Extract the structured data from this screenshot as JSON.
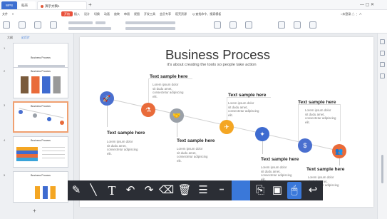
{
  "titlebar": {
    "home_tab": "WPS",
    "doc_tab": "稻壳",
    "active_tab": "演示文稿1",
    "new_tab": "+",
    "window_controls": "— ▢ ✕"
  },
  "menubar": {
    "items": [
      "文件",
      "≡",
      "开始",
      "插入",
      "设计",
      "切换",
      "动画",
      "放映",
      "审阅",
      "视图",
      "开发工具",
      "会员专享",
      "稻壳资源",
      "Q 查找命令、搜索模板"
    ],
    "right": "○未登录  △  ⋮  ∧"
  },
  "leftpanel": {
    "tabs": [
      "大纲",
      "幻灯片"
    ],
    "thumbs": [
      {
        "num": "1",
        "title": "Business Process"
      },
      {
        "num": "2",
        "title": "Business Process"
      },
      {
        "num": "3",
        "title": "Business Process"
      },
      {
        "num": "4",
        "title": "Business Process"
      },
      {
        "num": "5",
        "title": "Business Process"
      }
    ],
    "add_button": "+"
  },
  "slide": {
    "title": "Business Process",
    "subtitle": "it's about creating the tools so people take action",
    "steps": [
      {
        "title": "Text sample here",
        "lines": [
          "Lorem ipsum dolor",
          "sit dudu amet,",
          "consectetur adipiscing",
          "elit."
        ],
        "icon": "rocket-icon",
        "color": "#4a6fcf"
      },
      {
        "title": "Text sample here",
        "lines": [
          "Lorem ipsum dolor",
          "sit dudu amet,",
          "consectetur adipiscing",
          "elit."
        ],
        "icon": "flask-icon",
        "color": "#e96b3a"
      },
      {
        "title": "Text sample here",
        "lines": [
          "Lorem ipsum dolor",
          "sit dudu amet,",
          "consectetur adipiscing",
          "elit."
        ],
        "icon": "handshake-icon",
        "color": "#9aa0a8"
      },
      {
        "title": "Text sample here",
        "lines": [
          "Lorem ipsum dolor",
          "sit dudu amet,",
          "consectetur adipiscing",
          "elit."
        ],
        "icon": "paper-plane-icon",
        "color": "#f4a623"
      },
      {
        "title": "Text sample here",
        "lines": [
          "Lorem ipsum dolor",
          "sit dudu amet,",
          "consectetur adipiscing",
          "elit."
        ],
        "icon": "puzzle-icon",
        "color": "#3e6bd0"
      },
      {
        "title": "Text sample here",
        "lines": [
          "Lorem ipsum dolor",
          "sit dudu amet,",
          "consectetur adipiscing",
          "elit."
        ],
        "icon": "money-bag-icon",
        "color": "#4a6fcf"
      },
      {
        "title": "Text sample here",
        "lines": [
          "Lorem ipsum dolor",
          "sit dudu amet,",
          "consectetur adipiscing",
          "elit."
        ],
        "icon": "people-icon",
        "color": "#e96b3a"
      }
    ]
  },
  "penbar": {
    "tools": [
      "pen-icon",
      "line-icon",
      "text-icon",
      "undo-icon",
      "redo-icon",
      "eraser-icon",
      "delete-icon",
      "menu-icon",
      "line-style-icon",
      "color-icon",
      "screenshot-icon",
      "image-icon",
      "mouse-icon",
      "exit-icon"
    ],
    "text_glyph": "T"
  },
  "colors": {
    "accent": "#3a78d9",
    "toolbar_bg": "#2b2e35",
    "start_tab": "#e9503a"
  }
}
